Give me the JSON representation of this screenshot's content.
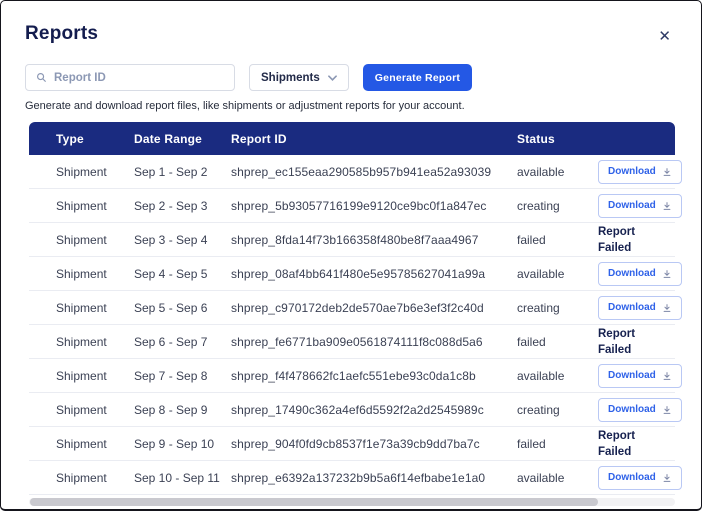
{
  "modal": {
    "title": "Reports",
    "close_glyph": "✕"
  },
  "controls": {
    "search_placeholder": "Report ID",
    "type_select_value": "Shipments",
    "generate_button_label": "Generate Report"
  },
  "description": "Generate and download report files, like shipments or adjustment reports for your account.",
  "table": {
    "columns": {
      "type": "Type",
      "date_range": "Date Range",
      "report_id": "Report ID",
      "status": "Status"
    },
    "download_label": "Download",
    "failed_label": "Report Failed",
    "rows": [
      {
        "type": "Shipment",
        "date_range": "Sep 1 - Sep 2",
        "report_id": "shprep_ec155eaa290585b957b941ea52a93039",
        "status": "available",
        "action": "download"
      },
      {
        "type": "Shipment",
        "date_range": "Sep 2 - Sep 3",
        "report_id": "shprep_5b93057716199e9120ce9bc0f1a847ec",
        "status": "creating",
        "action": "download"
      },
      {
        "type": "Shipment",
        "date_range": "Sep 3 - Sep 4",
        "report_id": "shprep_8fda14f73b166358f480be8f7aaa4967",
        "status": "failed",
        "action": "failed"
      },
      {
        "type": "Shipment",
        "date_range": "Sep 4 - Sep 5",
        "report_id": "shprep_08af4bb641f480e5e95785627041a99a",
        "status": "available",
        "action": "download"
      },
      {
        "type": "Shipment",
        "date_range": "Sep 5 - Sep 6",
        "report_id": "shprep_c970172deb2de570ae7b6e3ef3f2c40d",
        "status": "creating",
        "action": "download"
      },
      {
        "type": "Shipment",
        "date_range": "Sep 6 - Sep 7",
        "report_id": "shprep_fe6771ba909e0561874111f8c088d5a6",
        "status": "failed",
        "action": "failed"
      },
      {
        "type": "Shipment",
        "date_range": "Sep 7 - Sep 8",
        "report_id": "shprep_f4f478662fc1aefc551ebe93c0da1c8b",
        "status": "available",
        "action": "download"
      },
      {
        "type": "Shipment",
        "date_range": "Sep 8 - Sep 9",
        "report_id": "shprep_17490c362a4ef6d5592f2a2d2545989c",
        "status": "creating",
        "action": "download"
      },
      {
        "type": "Shipment",
        "date_range": "Sep 9 - Sep 10",
        "report_id": "shprep_904f0fd9cb8537f1e73a39cb9dd7ba7c",
        "status": "failed",
        "action": "failed"
      },
      {
        "type": "Shipment",
        "date_range": "Sep 10 - Sep 11",
        "report_id": "shprep_e6392a137232b9b5a6f14efbabe1e1a0",
        "status": "available",
        "action": "download"
      }
    ]
  },
  "colors": {
    "table_header_bg": "#1a2b80",
    "primary_button_bg": "#2458e5",
    "download_text": "#2f62e8",
    "download_border": "#b9c8f4",
    "title_text": "#131c4e",
    "body_text": "#3b4154",
    "placeholder_text": "#8c98b4"
  }
}
